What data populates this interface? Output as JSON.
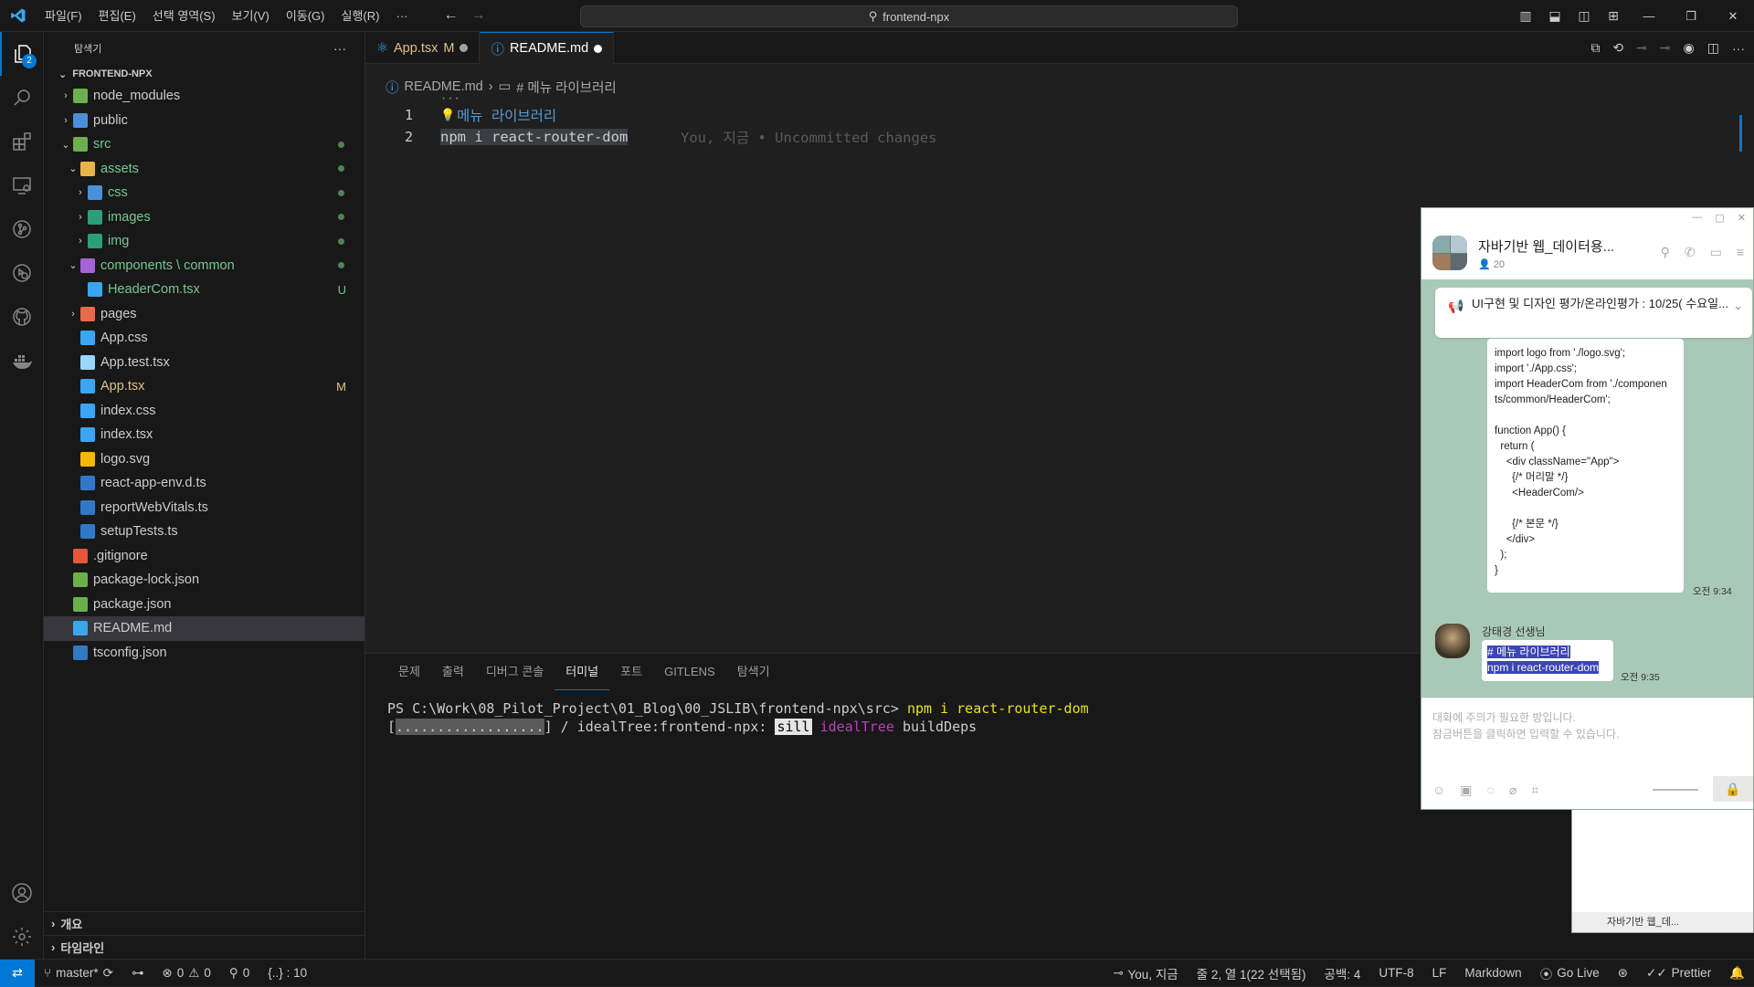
{
  "titlebar": {
    "menu": [
      "파일(F)",
      "편집(E)",
      "선택 영역(S)",
      "보기(V)",
      "이동(G)",
      "실행(R)",
      "···"
    ],
    "search": "frontend-npx"
  },
  "activity": {
    "explorer_badge": "2"
  },
  "sidebar": {
    "title": "탐색기",
    "root": "FRONTEND-NPX",
    "items": [
      {
        "label": "node_modules",
        "indent": 1,
        "chev": "›",
        "color": "#cccccc",
        "icon": "#6ab04c"
      },
      {
        "label": "public",
        "indent": 1,
        "chev": "›",
        "color": "#cccccc",
        "icon": "#4a90d9"
      },
      {
        "label": "src",
        "indent": 1,
        "chev": "⌄",
        "color": "#73c991",
        "icon": "#6ab04c",
        "dot": true
      },
      {
        "label": "assets",
        "indent": 2,
        "chev": "⌄",
        "color": "#73c991",
        "icon": "#e8b54a",
        "dot": true
      },
      {
        "label": "css",
        "indent": 3,
        "chev": "›",
        "color": "#73c991",
        "icon": "#4a90d9",
        "dot": true
      },
      {
        "label": "images",
        "indent": 3,
        "chev": "›",
        "color": "#73c991",
        "icon": "#2e9e7a",
        "dot": true
      },
      {
        "label": "img",
        "indent": 3,
        "chev": "›",
        "color": "#73c991",
        "icon": "#2e9e7a",
        "dot": true
      },
      {
        "label": "components \\ common",
        "indent": 2,
        "chev": "⌄",
        "color": "#73c991",
        "icon": "#a463d6",
        "dot": true
      },
      {
        "label": "HeaderCom.tsx",
        "indent": 3,
        "chev": "",
        "color": "#73c991",
        "icon": "#3aa6f0",
        "dec": "U"
      },
      {
        "label": "pages",
        "indent": 2,
        "chev": "›",
        "color": "#cccccc",
        "icon": "#e86a4a"
      },
      {
        "label": "App.css",
        "indent": 2,
        "chev": "",
        "color": "#cccccc",
        "icon": "#3aa6f0"
      },
      {
        "label": "App.test.tsx",
        "indent": 2,
        "chev": "",
        "color": "#cccccc",
        "icon": "#9bd6ff"
      },
      {
        "label": "App.tsx",
        "indent": 2,
        "chev": "",
        "color": "#e2c08d",
        "icon": "#3aa6f0",
        "dec": "M"
      },
      {
        "label": "index.css",
        "indent": 2,
        "chev": "",
        "color": "#cccccc",
        "icon": "#3aa6f0"
      },
      {
        "label": "index.tsx",
        "indent": 2,
        "chev": "",
        "color": "#cccccc",
        "icon": "#3aa6f0"
      },
      {
        "label": "logo.svg",
        "indent": 2,
        "chev": "",
        "color": "#cccccc",
        "icon": "#f5b800"
      },
      {
        "label": "react-app-env.d.ts",
        "indent": 2,
        "chev": "",
        "color": "#cccccc",
        "icon": "#3178c6"
      },
      {
        "label": "reportWebVitals.ts",
        "indent": 2,
        "chev": "",
        "color": "#cccccc",
        "icon": "#3178c6"
      },
      {
        "label": "setupTests.ts",
        "indent": 2,
        "chev": "",
        "color": "#cccccc",
        "icon": "#3178c6"
      },
      {
        "label": ".gitignore",
        "indent": 1,
        "chev": "",
        "color": "#cccccc",
        "icon": "#e8553a"
      },
      {
        "label": "package-lock.json",
        "indent": 1,
        "chev": "",
        "color": "#cccccc",
        "icon": "#6ab04c"
      },
      {
        "label": "package.json",
        "indent": 1,
        "chev": "",
        "color": "#cccccc",
        "icon": "#6ab04c"
      },
      {
        "label": "README.md",
        "indent": 1,
        "chev": "",
        "color": "#cccccc",
        "icon": "#3aa6f0",
        "selected": true
      },
      {
        "label": "tsconfig.json",
        "indent": 1,
        "chev": "",
        "color": "#cccccc",
        "icon": "#3178c6"
      }
    ],
    "outline": "개요",
    "timeline": "타임라인"
  },
  "tabs": [
    {
      "label": "App.tsx",
      "mark": "M",
      "active": false
    },
    {
      "label": "README.md",
      "mark": "",
      "active": true
    }
  ],
  "breadcrumb": {
    "file": "README.md",
    "sep": "›",
    "symbol": "# 메뉴 라이브러리"
  },
  "editor": {
    "ellipsis": "···",
    "lines": [
      {
        "num": "1",
        "text": "메뉴 라이브러리"
      },
      {
        "num": "2",
        "text": "npm i react-router-dom"
      }
    ],
    "blame": "You, 지금 • Uncommitted changes"
  },
  "panel": {
    "tabs": [
      "문제",
      "출력",
      "디버그 콘솔",
      "터미널",
      "포트",
      "GITLENS",
      "탐색기"
    ],
    "active_tab": "터미널",
    "prompt": "PS C:\\Work\\08_Pilot_Project\\01_Blog\\00_JSLIB\\frontend-npx\\src>",
    "command": "npm i react-router-dom",
    "progress_bar": "..................",
    "progress_text": "/ idealTree:frontend-npx:",
    "sill": "sill",
    "idealtree": "idealTree",
    "builddeps": "buildDeps"
  },
  "statusbar": {
    "branch": "master*",
    "errors": "0",
    "warnings": "0",
    "ports": "0",
    "symbols": "{..} : 10",
    "blame": "You, 지금",
    "position": "줄 2, 열 1(22 선택됨)",
    "spaces": "공백: 4",
    "encoding": "UTF-8",
    "eol": "LF",
    "language": "Markdown",
    "golive": "Go Live",
    "prettier": "Prettier"
  },
  "chat": {
    "title": "자바기반 웹_데이터용...",
    "members": "20",
    "notice": "UI구현 및 디자인 평가/온라인평가 : 10/25( 수요일...",
    "code": "import logo from './logo.svg';\nimport './App.css';\nimport HeaderCom from './componen\nts/common/HeaderCom';\n\nfunction App() {\n  return (\n    <div className=\"App\">\n      {/* 머리말 */}\n      <HeaderCom/>\n\n      {/* 본문 */}\n    </div>\n  );\n}\n\nexport default App;",
    "time1": "오전 9:34",
    "sender": "강태경 선생님",
    "msg_line1": "# 메뉴 라이브러리",
    "msg_line2": "npm i react-router-dom",
    "time2": "오전 9:35",
    "input_placeholder_1": "대화에 주의가 필요한 방입니다.",
    "input_placeholder_2": "잠금버튼을 클릭하면 입력할 수 있습니다.",
    "mini_title": "자바기반 웹_데..."
  }
}
